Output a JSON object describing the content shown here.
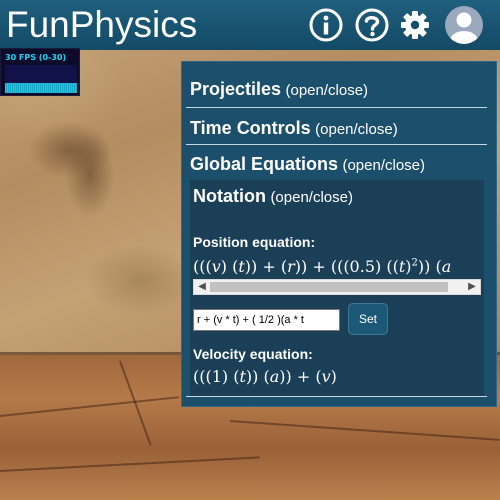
{
  "app": {
    "title": "FunPhysics",
    "header_icons": [
      "info-icon",
      "help-icon",
      "gear-icon",
      "user-avatar-icon"
    ]
  },
  "fps": {
    "label": "30 FPS (0-30)"
  },
  "panel": {
    "sections": [
      {
        "name": "Projectiles",
        "toggle": "(open/close)"
      },
      {
        "name": "Time Controls",
        "toggle": "(open/close)"
      },
      {
        "name": "Global Equations",
        "toggle": "(open/close)"
      }
    ],
    "notation": {
      "name": "Notation",
      "toggle": "(open/close)",
      "position_label": "Position equation:",
      "position_input": "r + (v * t) + ( 1/2 )(a * t",
      "set_label": "Set",
      "velocity_label": "Velocity equation:"
    }
  },
  "colors": {
    "header": "#1f5f7e",
    "panel": "#1c4f6b",
    "notation_bg": "#1a3f57",
    "fps_text": "#22d3f0"
  }
}
